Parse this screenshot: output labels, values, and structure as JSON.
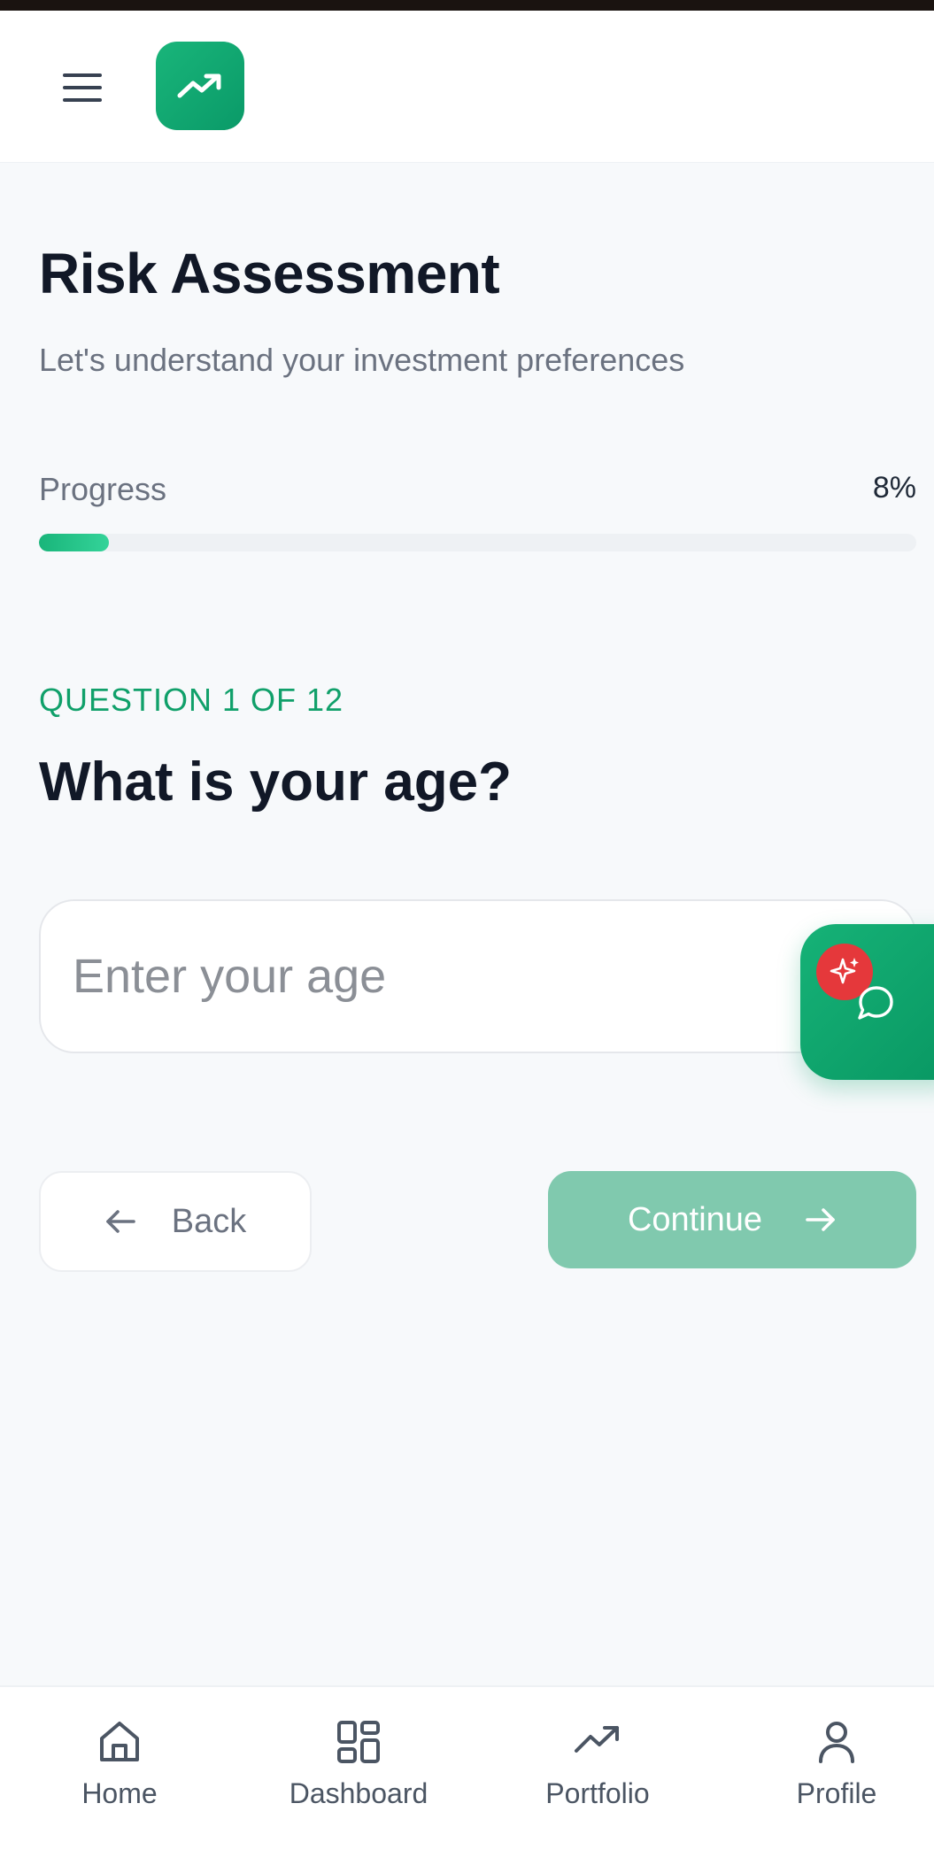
{
  "header": {
    "menu_icon": "hamburger-menu-icon",
    "logo_icon": "trending-up-icon",
    "brand_color": "#10a06a"
  },
  "page": {
    "title": "Risk Assessment",
    "subtitle": "Let's understand your investment preferences"
  },
  "progress": {
    "label": "Progress",
    "value_text": "8%",
    "value": 0.08
  },
  "question": {
    "counter": "QUESTION 1 OF 12",
    "text": "What is your age?",
    "input_placeholder": "Enter your age",
    "input_value": ""
  },
  "chat_fab": {
    "badge_icon": "sparkle-icon",
    "icon": "chat-bubble-icon"
  },
  "actions": {
    "back_label": "Back",
    "continue_label": "Continue",
    "continue_color": "#80c9ae"
  },
  "bottom_nav": {
    "items": [
      {
        "label": "Home",
        "icon": "home-icon"
      },
      {
        "label": "Dashboard",
        "icon": "dashboard-grid-icon"
      },
      {
        "label": "Portfolio",
        "icon": "trending-up-icon"
      },
      {
        "label": "Profile",
        "icon": "user-icon"
      }
    ]
  }
}
